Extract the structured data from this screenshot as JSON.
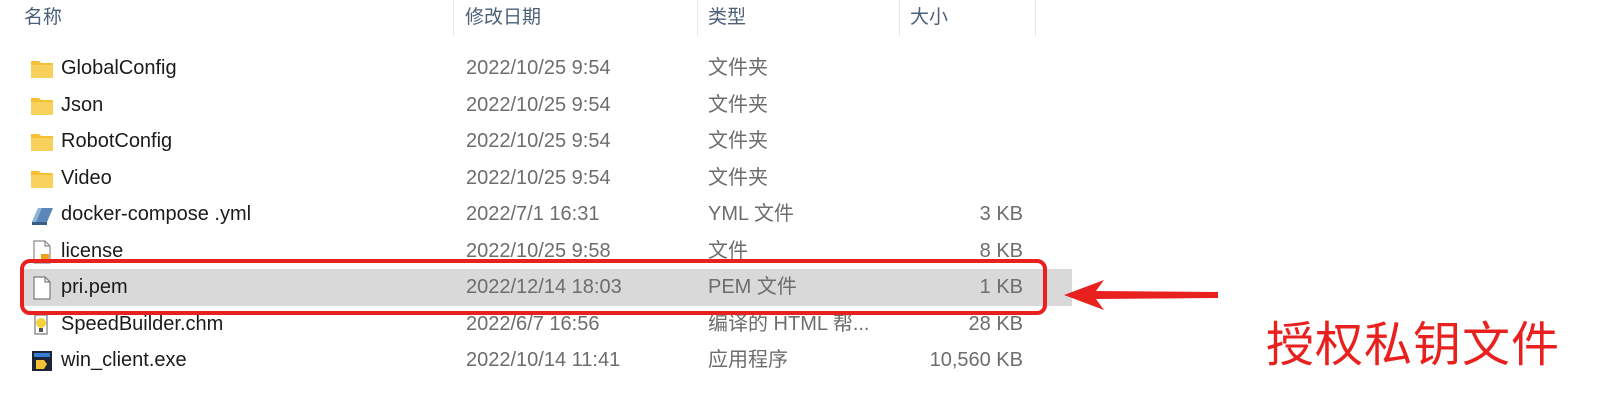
{
  "columns": {
    "name": "名称",
    "date": "修改日期",
    "type": "类型",
    "size": "大小"
  },
  "files": [
    {
      "name": "GlobalConfig",
      "date": "2022/10/25 9:54",
      "type": "文件夹",
      "size": "",
      "icon": "folder-icon"
    },
    {
      "name": "Json",
      "date": "2022/10/25 9:54",
      "type": "文件夹",
      "size": "",
      "icon": "folder-icon"
    },
    {
      "name": "RobotConfig",
      "date": "2022/10/25 9:54",
      "type": "文件夹",
      "size": "",
      "icon": "folder-icon"
    },
    {
      "name": "Video",
      "date": "2022/10/25 9:54",
      "type": "文件夹",
      "size": "",
      "icon": "folder-icon"
    },
    {
      "name": "docker-compose .yml",
      "date": "2022/7/1 16:31",
      "type": "YML 文件",
      "size": "3 KB",
      "icon": "yml-file-icon"
    },
    {
      "name": "license",
      "date": "2022/10/25 9:58",
      "type": "文件",
      "size": "8 KB",
      "icon": "license-file-icon"
    },
    {
      "name": "pri.pem",
      "date": "2022/12/14 18:03",
      "type": "PEM 文件",
      "size": "1 KB",
      "icon": "blank-file-icon",
      "selected": true
    },
    {
      "name": "SpeedBuilder.chm",
      "date": "2022/6/7 16:56",
      "type": "编译的 HTML 帮...",
      "size": "28 KB",
      "icon": "chm-file-icon"
    },
    {
      "name": "win_client.exe",
      "date": "2022/10/14 11:41",
      "type": "应用程序",
      "size": "10,560 KB",
      "icon": "exe-file-icon"
    }
  ],
  "annotation": {
    "text": "授权私钥文件",
    "color": "#e8211f"
  },
  "colors": {
    "selected_row": "#d9d9d9",
    "header_text": "#4c607a",
    "folder": "#f5c033"
  }
}
